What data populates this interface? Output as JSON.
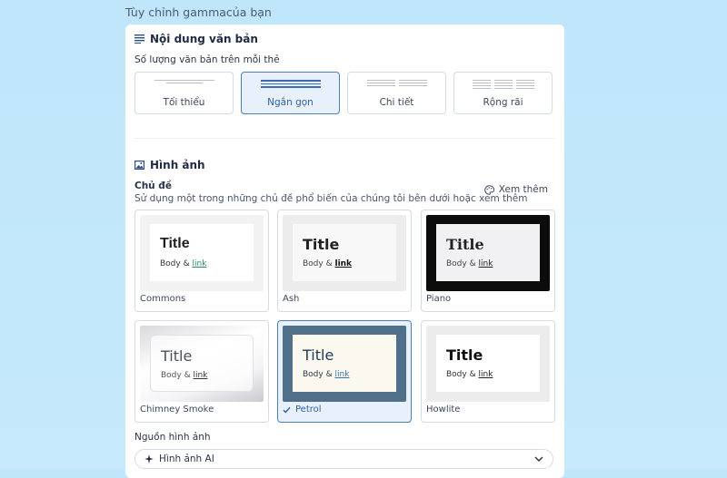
{
  "page": {
    "heading": "Tùy chỉnh gammacủa bạn"
  },
  "text_content": {
    "title": "Nội dung văn bản",
    "amount_label": "Số lượng văn bản trên mỗi thẻ",
    "options": [
      {
        "label": "Tối thiểu",
        "selected": false
      },
      {
        "label": "Ngắn gọn",
        "selected": true
      },
      {
        "label": "Chi tiết",
        "selected": false
      },
      {
        "label": "Rộng rãi",
        "selected": false
      }
    ]
  },
  "images": {
    "title": "Hình ảnh",
    "theme_label": "Chủ đề",
    "theme_hint": "Sử dụng một trong những chủ đề phổ biến của chúng tôi bên dưới hoặc xem thêm",
    "see_more": "Xem thêm",
    "themes": [
      {
        "name": "Commons",
        "title": "Title",
        "body": "Body &",
        "link": "link",
        "selected": false
      },
      {
        "name": "Ash",
        "title": "Title",
        "body": "Body &",
        "link": "link",
        "selected": false
      },
      {
        "name": "Piano",
        "title": "Title",
        "body": "Body &",
        "link": "link",
        "selected": false
      },
      {
        "name": "Chimney Smoke",
        "title": "Title",
        "body": "Body &",
        "link": "link",
        "selected": false
      },
      {
        "name": "Petrol",
        "title": "Title",
        "body": "Body &",
        "link": "link",
        "selected": true
      },
      {
        "name": "Howlite",
        "title": "Title",
        "body": "Body &",
        "link": "link",
        "selected": false
      }
    ],
    "source_label": "Nguồn hình ảnh",
    "source_value": "Hình ảnh AI"
  },
  "colors": {
    "accent": "#3b6db1",
    "selected_bg": "#e8f1fb",
    "page_bg": "#c3e7fb"
  }
}
